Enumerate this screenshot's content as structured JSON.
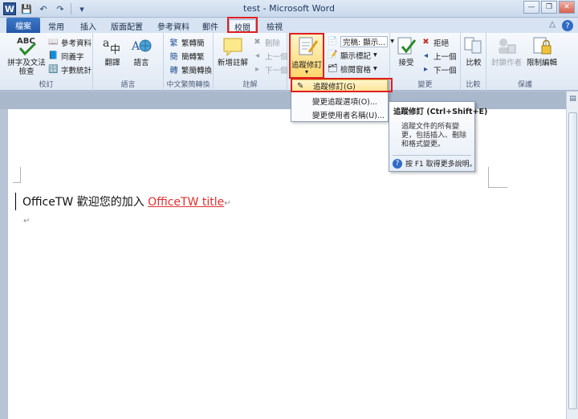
{
  "title": "test - Microsoft Word",
  "qat": {
    "word": "W",
    "save": "💾",
    "undo": "↶",
    "redo": "↷",
    "customize": "▾"
  },
  "window": {
    "minimize": "—",
    "restore": "❐",
    "close": "✕"
  },
  "tabs": {
    "file": "檔案",
    "items": [
      "常用",
      "插入",
      "版面配置",
      "參考資料",
      "郵件",
      "校閱",
      "檢視"
    ],
    "active_index": 5
  },
  "ribbon": {
    "proofing": {
      "label": "校訂",
      "spelling": "拼字及文法\n檢查",
      "research": "參考資料",
      "thesaurus": "同義字",
      "word_count": "字數統計"
    },
    "language": {
      "label": "語言",
      "translate": "翻譯",
      "language": "語言"
    },
    "chinese": {
      "label": "中文繁簡轉換",
      "to_simplified": "繁轉簡",
      "to_traditional": "簡轉繁",
      "convert": "繁簡轉換"
    },
    "comments": {
      "label": "註解",
      "new": "新增註解",
      "delete": "刪除",
      "previous": "上一個",
      "next": "下一個"
    },
    "tracking": {
      "label": "追蹤",
      "track_changes": "追蹤修訂",
      "display_mode": "完稿: 顯示...",
      "show_markup": "顯示標記",
      "reviewing_pane": "檢閱窗格"
    },
    "changes": {
      "label": "變更",
      "accept": "接受",
      "reject": "拒絕",
      "previous": "上一個",
      "next": "下一個"
    },
    "compare": {
      "label": "比較",
      "compare": "比較"
    },
    "protect": {
      "label": "保護",
      "block_authors": "封鎖作者",
      "restrict_editing": "限制編輯"
    }
  },
  "dropdown": {
    "items": [
      "追蹤修訂(G)",
      "變更追蹤選項(O)...",
      "變更使用者名稱(U)..."
    ],
    "hovered_index": 0
  },
  "tooltip": {
    "title": "追蹤修訂 (Ctrl+Shift+E)",
    "body": "追蹤文件的所有變更，包括插入、刪除和格式變更。",
    "help": "按 F1 取得更多說明。"
  },
  "document": {
    "line_plain": "OfficeTW 歡迎您的加入 ",
    "line_red": "OfficeTW title",
    "para_mark": "↵"
  },
  "colors": {
    "accent": "#2b5797",
    "highlight": "#e02020",
    "red_text": "#e03030"
  }
}
